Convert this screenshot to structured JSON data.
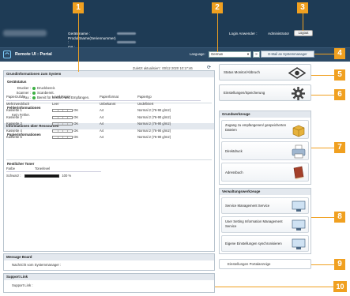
{
  "header": {
    "device_name_label": "Gerätename :",
    "product_label": "Produktname(Seriennummer) :",
    "location_label": "Ort :",
    "login_user_label": "Login Anwender :",
    "login_user_value": "Administrator",
    "logout_label": "Logout"
  },
  "navbar": {
    "brand": "Remote UI : Portal",
    "language_label": "Language:",
    "language_value": "German",
    "email_button": "E-Mail an Systemmanager"
  },
  "last_updated": "Zuletzt aktualisiert : 00/12 2020 10:17:46",
  "device_info": {
    "title": "Grundinformationen zum System",
    "status_title": "Gerätstatus",
    "status_rows": [
      {
        "label": "Drucker :",
        "value": "Druckbereit."
      },
      {
        "label": "Scanner :",
        "value": "Scanbereit."
      },
      {
        "label": "Fax :",
        "value": "Bereit für Senden und Empfangen."
      }
    ],
    "error_title": "Fehlerinformationen",
    "error_value": "Kein Fehler."
  },
  "consumables": {
    "title": "Informationen über Ressourcen",
    "paper_title": "Papierinformationen",
    "paper_headers": [
      "Papierzufuhr",
      "Level Papier",
      "Papierformat",
      "Papiertyp"
    ],
    "paper_rows": [
      {
        "source": "Mehrzweckfach",
        "level": "Leer",
        "format": "Unbekannt",
        "type": "Undefiniert",
        "show_bar": false
      },
      {
        "source": "Kassette 1",
        "level": "OK",
        "format": "A4",
        "type": "Normal 2 (76-90 g/m2)",
        "show_bar": true
      },
      {
        "source": "Kassette 2",
        "level": "OK",
        "format": "A4",
        "type": "Normal 2 (76-90 g/m2)",
        "show_bar": true
      },
      {
        "source": "Kassette 3",
        "level": "OK",
        "format": "A4",
        "type": "Normal 2 (76-90 g/m2)",
        "show_bar": true
      },
      {
        "source": "Kassette 4",
        "level": "OK",
        "format": "A4",
        "type": "Normal 2 (76-90 g/m2)",
        "show_bar": true
      },
      {
        "source": "Kassette 5",
        "level": "OK",
        "format": "A4",
        "type": "Normal 2 (76-90 g/m2)",
        "show_bar": true
      }
    ],
    "toner_title": "Restlicher Toner",
    "toner_headers": [
      "Farbe",
      "Tonerlevel"
    ],
    "toner_color": "Schwarz :",
    "toner_percent_label": "100 %",
    "toner_level": 1.0
  },
  "message_board": {
    "title": "Message Board",
    "text": "Nachricht vom Systemmanager :"
  },
  "support_link": {
    "title": "Support Link",
    "text": "Support Link :"
  },
  "right": {
    "status_monitor": "Status Monitor/Abbruch",
    "settings": "Einstellungen/Speicherung",
    "basic_tools_title": "Grundwerkzeuge",
    "basic_tools": [
      "Zugang zu empfangenen/ gespeicherten Dateien",
      "Direktdruck",
      "Adressbuch"
    ],
    "admin_tools_title": "Verwaltungswerkzeuge",
    "admin_tools": [
      "Service Management Service",
      "User Setting Information Management Service",
      "Eigene Einstellungen synchronisieren"
    ],
    "portal_settings": "Einstellungen Portalanzeige"
  },
  "callouts": [
    "1",
    "2",
    "3",
    "4",
    "5",
    "6",
    "7",
    "8",
    "9",
    "10"
  ],
  "colors": {
    "header_bg": "#1e3b55",
    "callout": "#f0a020",
    "status_ok": "#3cb043"
  }
}
